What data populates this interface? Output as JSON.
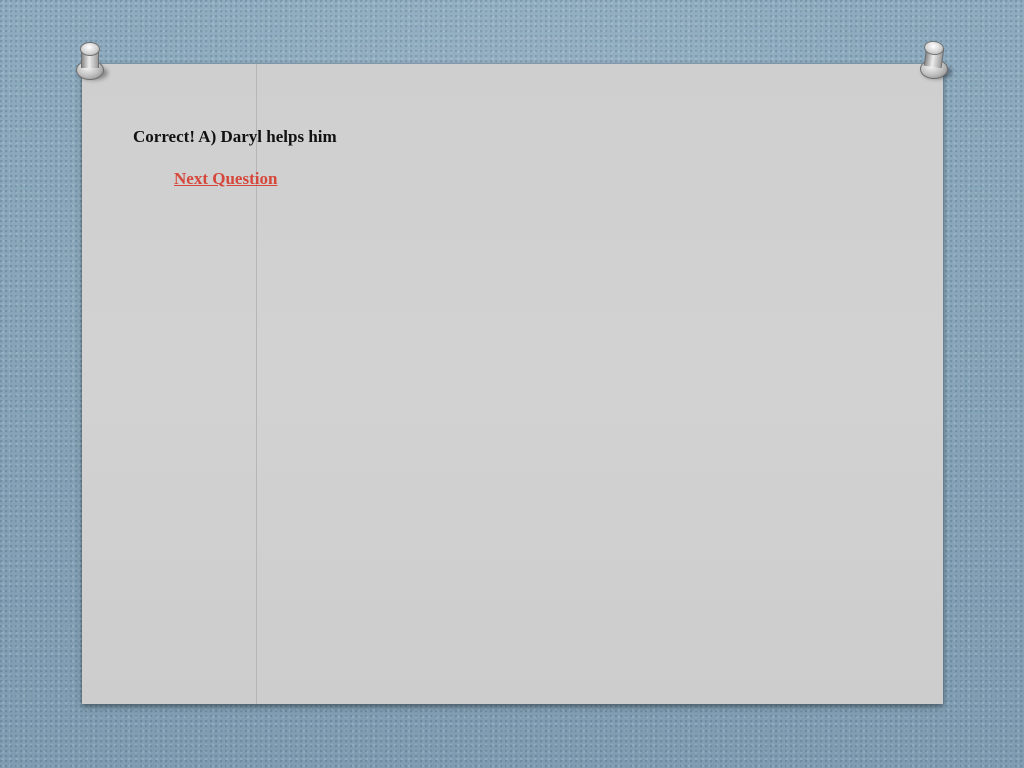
{
  "slide": {
    "answer_text": "Correct! A) Daryl helps him",
    "next_link_label": "Next Question"
  },
  "colors": {
    "background": "#87a4b8",
    "paper": "#d0d0d0",
    "text": "#111111",
    "link": "#d6473b"
  },
  "icons": {
    "pin_left": "push-pin-icon",
    "pin_right": "push-pin-icon"
  }
}
